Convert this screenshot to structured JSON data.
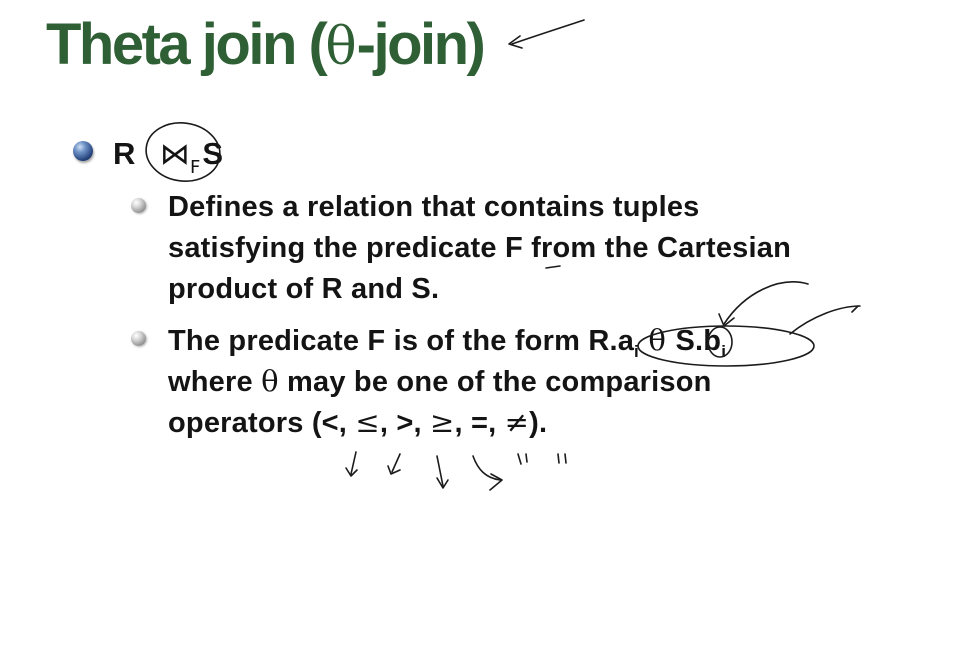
{
  "slide": {
    "title_prefix": "Theta join (",
    "title_theta": "θ",
    "title_suffix": "-join)",
    "bullet1": {
      "left": "R",
      "join_symbol": "⋈",
      "join_subscript": "F",
      "right": "S"
    },
    "bullet2": {
      "lines": [
        "Defines a relation that contains tuples",
        "satisfying the predicate F from the Cartesian",
        "product of R and S."
      ]
    },
    "bullet3": {
      "line1_prefix": "The predicate F is of the form R.a",
      "line1_sub_a": "i",
      "line1_theta": " θ ",
      "line1_s": "S.b",
      "line1_sub_b": "i",
      "line2_prefix": "where ",
      "line2_theta": "θ",
      "line2_suffix": " may be one of the comparison",
      "line3_prefix": "operators (<, ",
      "op_le": "≤",
      "op_gt": ", >, ",
      "op_ge": "≥",
      "op_eq": ", =, ",
      "op_ne": "≠",
      "line3_suffix": ")."
    }
  }
}
